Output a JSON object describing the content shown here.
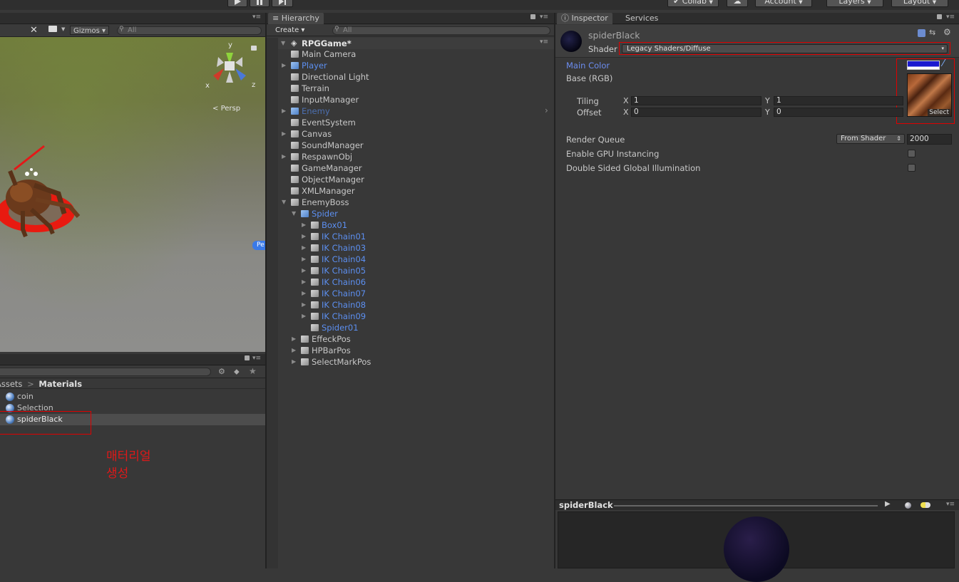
{
  "toolbar": {
    "collab": "Collab",
    "account": "Account",
    "layers": "Layers",
    "layout": "Layout"
  },
  "scene": {
    "gizmos": "Gizmos",
    "search_placeholder": "All",
    "persp": "Persp",
    "axis_x": "x",
    "axis_y": "y",
    "axis_z": "z"
  },
  "project": {
    "breadcrumb_root": "Assets",
    "breadcrumb_sep": ">",
    "breadcrumb_current": "Materials",
    "items": [
      "coin",
      "Selection",
      "spiderBlack"
    ],
    "annotation_line1": "매터리얼",
    "annotation_line2": "생성"
  },
  "hierarchy": {
    "tab": "Hierarchy",
    "create": "Create",
    "search_placeholder": "All",
    "scene_name": "RPGGame*",
    "rows": [
      {
        "label": "Main Camera",
        "depth": 0,
        "arrow": "",
        "icon": "gray",
        "style": ""
      },
      {
        "label": "Player",
        "depth": 0,
        "arrow": "right",
        "icon": "blue",
        "style": "prefab"
      },
      {
        "label": "Directional Light",
        "depth": 0,
        "arrow": "",
        "icon": "gray",
        "style": ""
      },
      {
        "label": "Terrain",
        "depth": 0,
        "arrow": "",
        "icon": "gray",
        "style": ""
      },
      {
        "label": "InputManager",
        "depth": 0,
        "arrow": "",
        "icon": "gray",
        "style": ""
      },
      {
        "label": "Enemy",
        "depth": 0,
        "arrow": "right",
        "icon": "blue",
        "style": "prefab-dim"
      },
      {
        "label": "EventSystem",
        "depth": 0,
        "arrow": "",
        "icon": "gray",
        "style": ""
      },
      {
        "label": "Canvas",
        "depth": 0,
        "arrow": "right",
        "icon": "gray",
        "style": ""
      },
      {
        "label": "SoundManager",
        "depth": 0,
        "arrow": "",
        "icon": "gray",
        "style": ""
      },
      {
        "label": "RespawnObj",
        "depth": 0,
        "arrow": "right",
        "icon": "gray",
        "style": ""
      },
      {
        "label": "GameManager",
        "depth": 0,
        "arrow": "",
        "icon": "gray",
        "style": ""
      },
      {
        "label": "ObjectManager",
        "depth": 0,
        "arrow": "",
        "icon": "gray",
        "style": ""
      },
      {
        "label": "XMLManager",
        "depth": 0,
        "arrow": "",
        "icon": "gray",
        "style": ""
      },
      {
        "label": "EnemyBoss",
        "depth": 0,
        "arrow": "down",
        "icon": "gray",
        "style": ""
      },
      {
        "label": "Spider",
        "depth": 1,
        "arrow": "down",
        "icon": "blue",
        "style": "prefab"
      },
      {
        "label": "Box01",
        "depth": 2,
        "arrow": "right",
        "icon": "gray",
        "style": "prefab"
      },
      {
        "label": "IK Chain01",
        "depth": 2,
        "arrow": "right",
        "icon": "gray",
        "style": "prefab"
      },
      {
        "label": "IK Chain03",
        "depth": 2,
        "arrow": "right",
        "icon": "gray",
        "style": "prefab"
      },
      {
        "label": "IK Chain04",
        "depth": 2,
        "arrow": "right",
        "icon": "gray",
        "style": "prefab"
      },
      {
        "label": "IK Chain05",
        "depth": 2,
        "arrow": "right",
        "icon": "gray",
        "style": "prefab"
      },
      {
        "label": "IK Chain06",
        "depth": 2,
        "arrow": "right",
        "icon": "gray",
        "style": "prefab"
      },
      {
        "label": "IK Chain07",
        "depth": 2,
        "arrow": "right",
        "icon": "gray",
        "style": "prefab"
      },
      {
        "label": "IK Chain08",
        "depth": 2,
        "arrow": "right",
        "icon": "gray",
        "style": "prefab"
      },
      {
        "label": "IK Chain09",
        "depth": 2,
        "arrow": "right",
        "icon": "gray",
        "style": "prefab"
      },
      {
        "label": "Spider01",
        "depth": 2,
        "arrow": "",
        "icon": "gray",
        "style": "prefab"
      },
      {
        "label": "EffeckPos",
        "depth": 1,
        "arrow": "right",
        "icon": "gray",
        "style": ""
      },
      {
        "label": "HPBarPos",
        "depth": 1,
        "arrow": "right",
        "icon": "gray",
        "style": ""
      },
      {
        "label": "SelectMarkPos",
        "depth": 1,
        "arrow": "right",
        "icon": "gray",
        "style": ""
      }
    ]
  },
  "inspector": {
    "tab": "Inspector",
    "tab2": "Services",
    "material_name": "spiderBlack",
    "shader_label": "Shader",
    "shader_value": "Legacy Shaders/Diffuse",
    "main_color_label": "Main Color",
    "base_label": "Base (RGB)",
    "tiling_label": "Tiling",
    "offset_label": "Offset",
    "x_label": "X",
    "y_label": "Y",
    "tiling_x": "1",
    "tiling_y": "1",
    "offset_x": "0",
    "offset_y": "0",
    "select_label": "Select",
    "render_queue_label": "Render Queue",
    "render_queue_mode": "From Shader",
    "render_queue_value": "2000",
    "gpu_instancing_label": "Enable GPU Instancing",
    "double_sided_label": "Double Sided Global Illumination",
    "preview_title": "spiderBlack",
    "main_color_hex": "#1a1ad0"
  },
  "scene_label_cut": "Pe"
}
